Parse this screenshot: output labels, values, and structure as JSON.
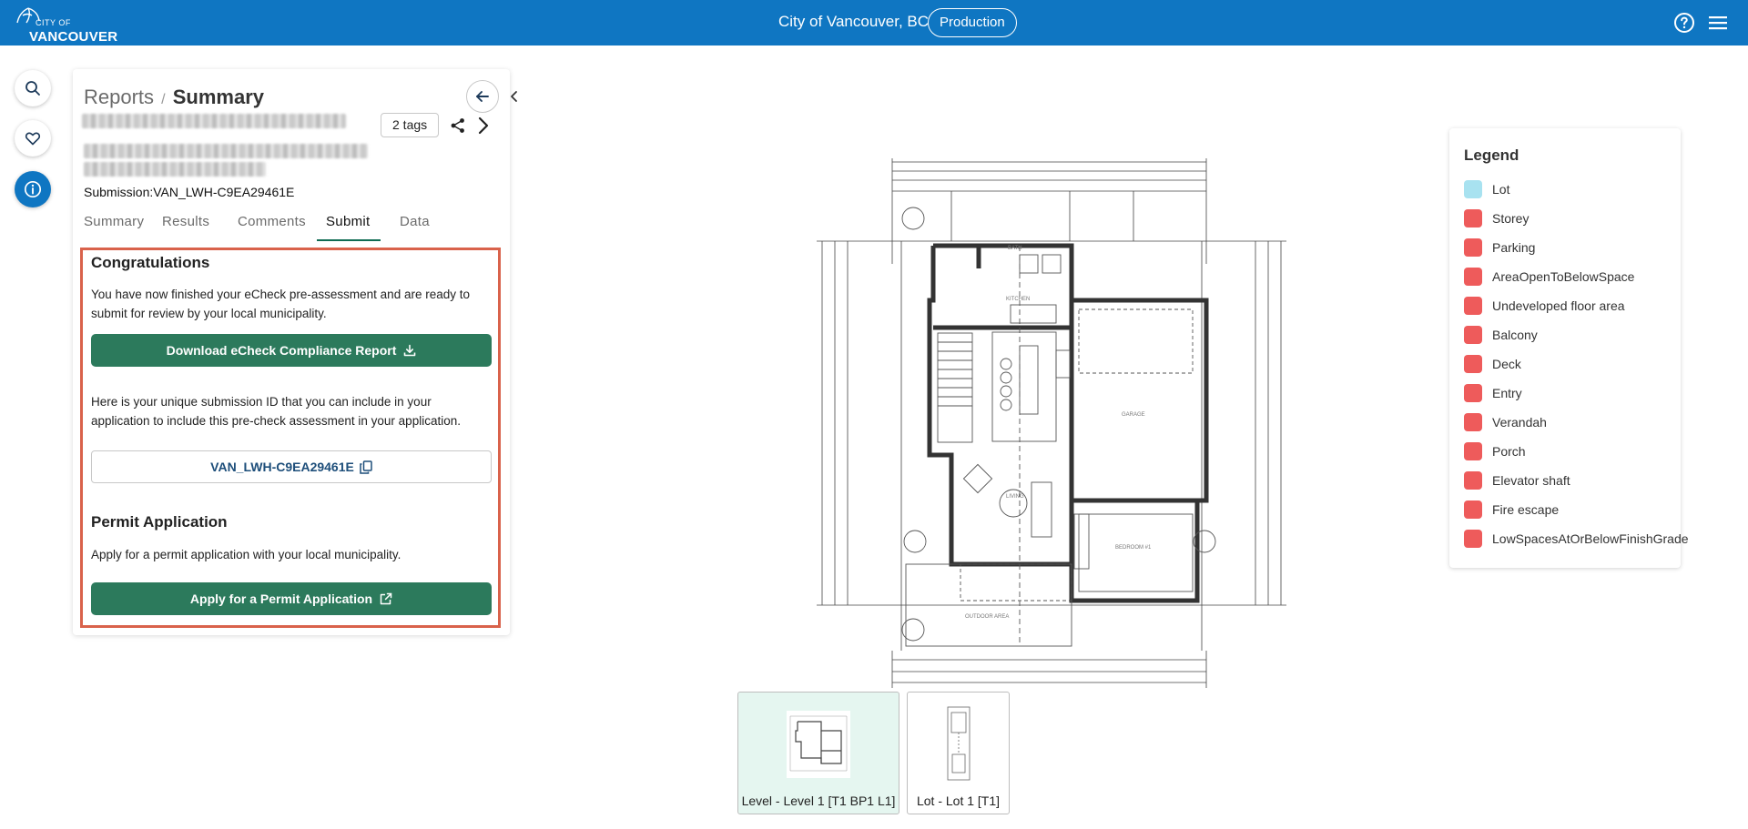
{
  "header": {
    "logo_line1": "CITY OF",
    "logo_line2": "VANCOUVER",
    "title": "City of Vancouver, BC",
    "environment": "Production"
  },
  "rail": {
    "items": [
      "search-icon",
      "heart-icon",
      "info-icon"
    ],
    "active": "info-icon"
  },
  "panel": {
    "breadcrumb_parent": "Reports",
    "breadcrumb_sep": "/",
    "breadcrumb_current": "Summary",
    "tags_label": "2 tags",
    "submission_label": "Submission:VAN_LWH-C9EA29461E",
    "tabs": [
      {
        "label": "Summary"
      },
      {
        "label": "Results"
      },
      {
        "label": "Comments"
      },
      {
        "label": "Submit"
      },
      {
        "label": "Data"
      }
    ],
    "active_tab": "Submit"
  },
  "submit": {
    "congrats_title": "Congratulations",
    "congrats_text": "You have now finished your eCheck pre-assessment and are ready to submit for review by your local municipality.",
    "download_label": "Download eCheck Compliance Report",
    "id_text": "Here is your unique submission ID that you can include in your application to include this pre-check assessment in your application.",
    "submission_id": "VAN_LWH-C9EA29461E",
    "permit_title": "Permit Application",
    "permit_text": "Apply for a permit application with your local municipality.",
    "permit_button": "Apply for a Permit Application"
  },
  "viewer": {
    "thumbnails": [
      {
        "label": "Level - Level 1 [T1 BP1 L1]",
        "selected": true
      },
      {
        "label": "Lot - Lot 1 [T1]",
        "selected": false
      }
    ]
  },
  "legend": {
    "title": "Legend",
    "items": [
      {
        "label": "Lot",
        "color": "#a8e2f0"
      },
      {
        "label": "Storey",
        "color": "#ee5b5b"
      },
      {
        "label": "Parking",
        "color": "#ee5b5b"
      },
      {
        "label": "AreaOpenToBelowSpace",
        "color": "#ee5b5b"
      },
      {
        "label": "Undeveloped floor area",
        "color": "#ee5b5b"
      },
      {
        "label": "Balcony",
        "color": "#ee5b5b"
      },
      {
        "label": "Deck",
        "color": "#ee5b5b"
      },
      {
        "label": "Entry",
        "color": "#ee5b5b"
      },
      {
        "label": "Verandah",
        "color": "#ee5b5b"
      },
      {
        "label": "Porch",
        "color": "#ee5b5b"
      },
      {
        "label": "Elevator shaft",
        "color": "#ee5b5b"
      },
      {
        "label": "Fire escape",
        "color": "#ee5b5b"
      },
      {
        "label": "LowSpacesAtOrBelowFinishGrade",
        "color": "#ee5b5b"
      }
    ]
  },
  "colors": {
    "brand_blue": "#0f76c2",
    "action_green": "#2c7a5c",
    "highlight_border": "#d9624b"
  }
}
